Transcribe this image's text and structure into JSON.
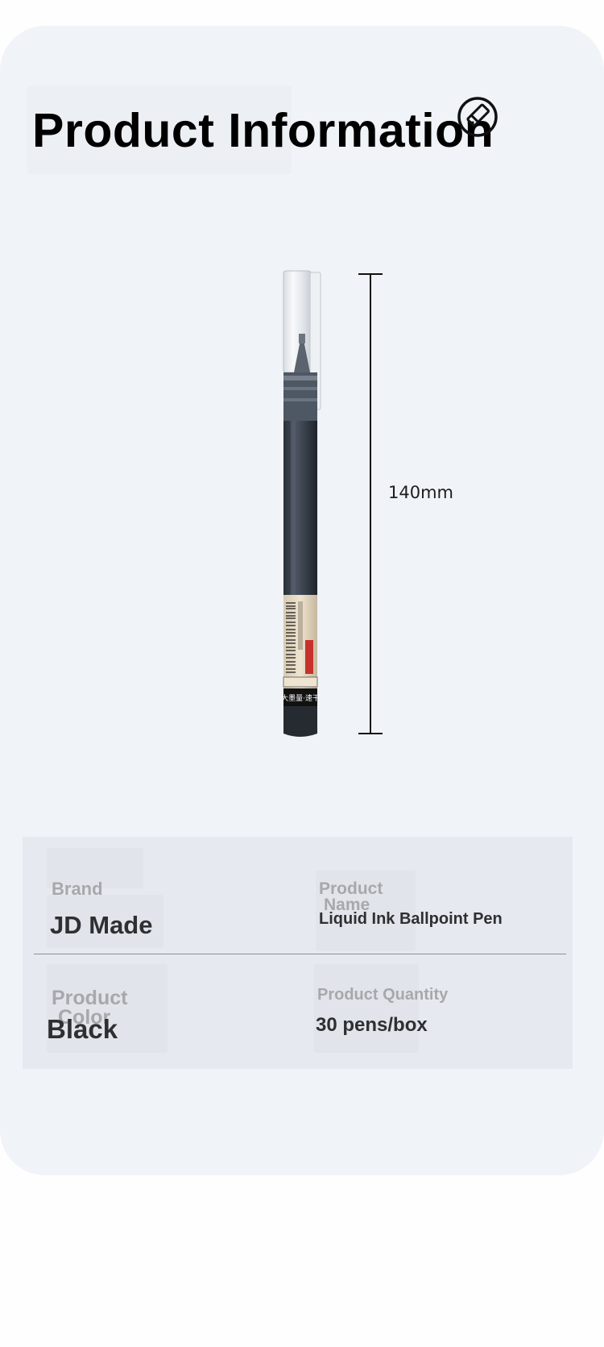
{
  "page": {
    "title": "Product Information",
    "accent_color": "#f0f3f8",
    "title_icon": "edit-icon"
  },
  "product_image": {
    "dimension_label": "140mm",
    "pen_label_text": "大墨量·速干"
  },
  "specs": {
    "brand": {
      "label": "Brand",
      "value": "JD Made"
    },
    "product_name": {
      "label_line1": "Product",
      "label_line2": "Name",
      "value": "Liquid Ink Ballpoint Pen"
    },
    "product_color": {
      "label_line1": "Product",
      "label_line2": "Color",
      "value": "Black"
    },
    "product_quantity": {
      "label": "Product Quantity",
      "value": "30 pens/box"
    }
  }
}
